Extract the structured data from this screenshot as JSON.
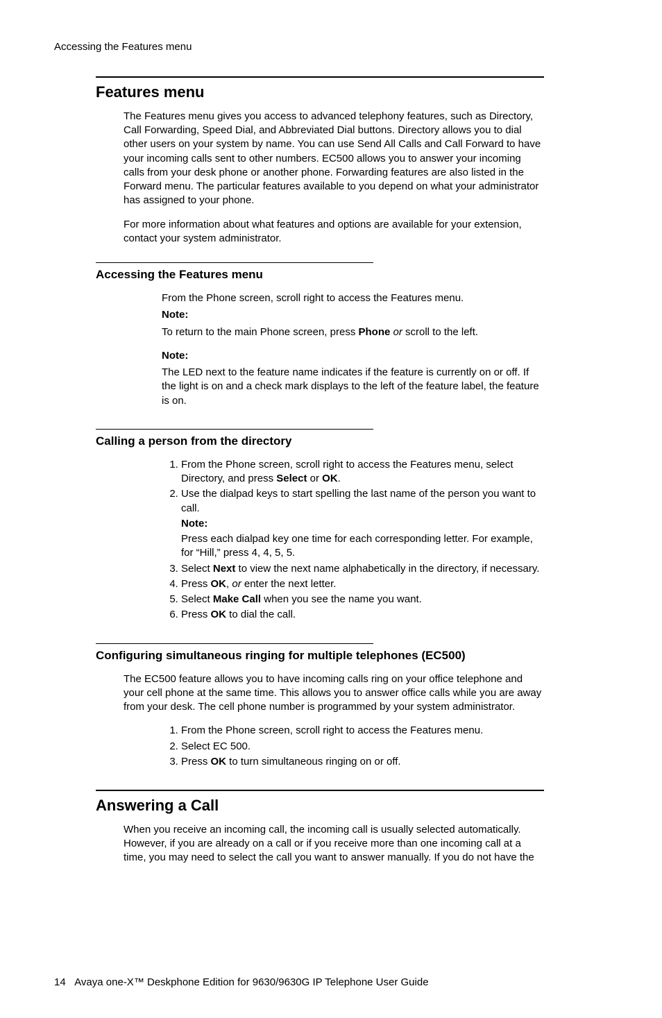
{
  "header": "Accessing the Features menu",
  "section1": {
    "title": "Features menu",
    "p1": "The Features menu gives you access to advanced telephony features, such as Directory, Call Forwarding, Speed Dial, and Abbreviated Dial buttons. Directory allows you to dial other users on your system by name. You can use Send All Calls and Call Forward to have your incoming calls sent to other numbers. EC500 allows you to answer your incoming calls from your desk phone or another phone. Forwarding features are also listed in the Forward menu. The particular features available to you depend on what your administrator has assigned to your phone.",
    "p2": "For more information about what features and options are available for your extension, contact your system administrator."
  },
  "section2": {
    "title": "Accessing the Features menu",
    "p1": "From the Phone screen, scroll right to access the Features menu.",
    "note_label": "Note:",
    "p2a": "To return to the main Phone screen, press ",
    "p2b": "Phone",
    "p2c": " or",
    "p2d": " scroll to the left.",
    "note2_label": "Note:",
    "p3": "The LED next to the feature name indicates if the feature is currently on or off. If the light is on and a check mark displays to the left of the feature label, the feature is on."
  },
  "section3": {
    "title": "Calling a person from the directory",
    "li1a": "From the Phone screen, scroll right to access the Features menu, select Directory, and press ",
    "li1b": "Select",
    "li1c": " or ",
    "li1d": "OK",
    "li1e": ".",
    "li2": "Use the dialpad keys to start spelling the last name of the person you want to call.",
    "li2_note_label": "Note:",
    "li2_note": "Press each dialpad key one time for each corresponding letter. For example, for “Hill,” press 4, 4, 5, 5.",
    "li3a": "Select ",
    "li3b": "Next",
    "li3c": " to view the next name alphabetically in the directory, if necessary.",
    "li4a": "Press ",
    "li4b": "OK",
    "li4c": ", ",
    "li4d": "or ",
    "li4e": "enter the next letter.",
    "li5a": "Select ",
    "li5b": "Make Call",
    "li5c": " when you see the name you want.",
    "li6a": "Press ",
    "li6b": "OK",
    "li6c": " to dial the call."
  },
  "section4": {
    "title": "Configuring simultaneous ringing for multiple telephones (EC500)",
    "p1": "The EC500 feature allows you to have incoming calls ring on your office telephone and your cell phone at the same time. This allows you to answer office calls while you are away from your desk. The cell phone number is programmed by your system administrator.",
    "li1": "From the Phone screen, scroll right to access the Features menu.",
    "li2": "Select EC 500.",
    "li3a": "Press ",
    "li3b": "OK",
    "li3c": " to turn simultaneous ringing on or off."
  },
  "section5": {
    "title": "Answering a Call",
    "p1": "When you receive an incoming call, the incoming call is usually selected automatically. However, if you are already on a call or if you receive more than one incoming call at a time, you may need to select the call you want to answer manually. If you do not have the"
  },
  "footer": {
    "page": "14",
    "text": "Avaya one-X™ Deskphone Edition for 9630/9630G IP Telephone User Guide"
  }
}
